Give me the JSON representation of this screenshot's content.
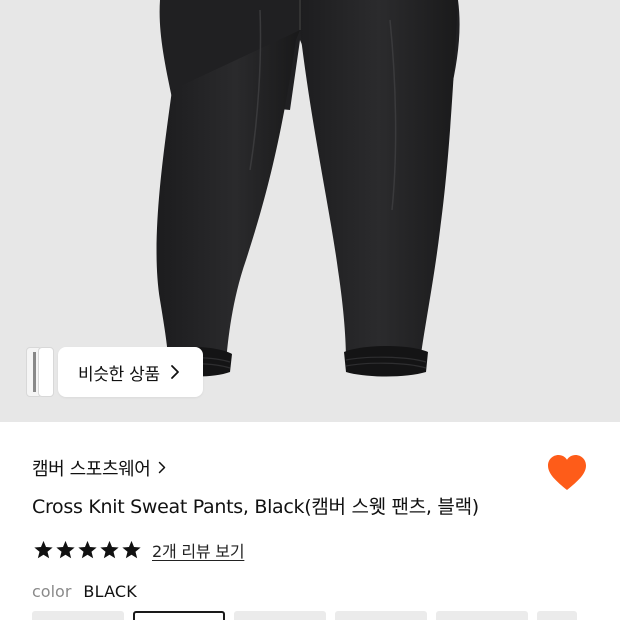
{
  "similar": {
    "label": "비슷한 상품"
  },
  "brand": {
    "name": "캠버 스포츠웨어"
  },
  "product": {
    "title": "Cross Knit Sweat Pants, Black(캠버 스웻 팬츠, 블랙)",
    "liked": true
  },
  "rating": {
    "stars": 5,
    "max": 5,
    "review_link": "2개 리뷰 보기"
  },
  "color": {
    "key": "color",
    "value": "BLACK",
    "swatch_count": 6,
    "selected_index": 1
  },
  "theme": {
    "heart_color": "#fe5c19",
    "star_color": "#111111",
    "hero_bg": "#e7e7e7"
  }
}
